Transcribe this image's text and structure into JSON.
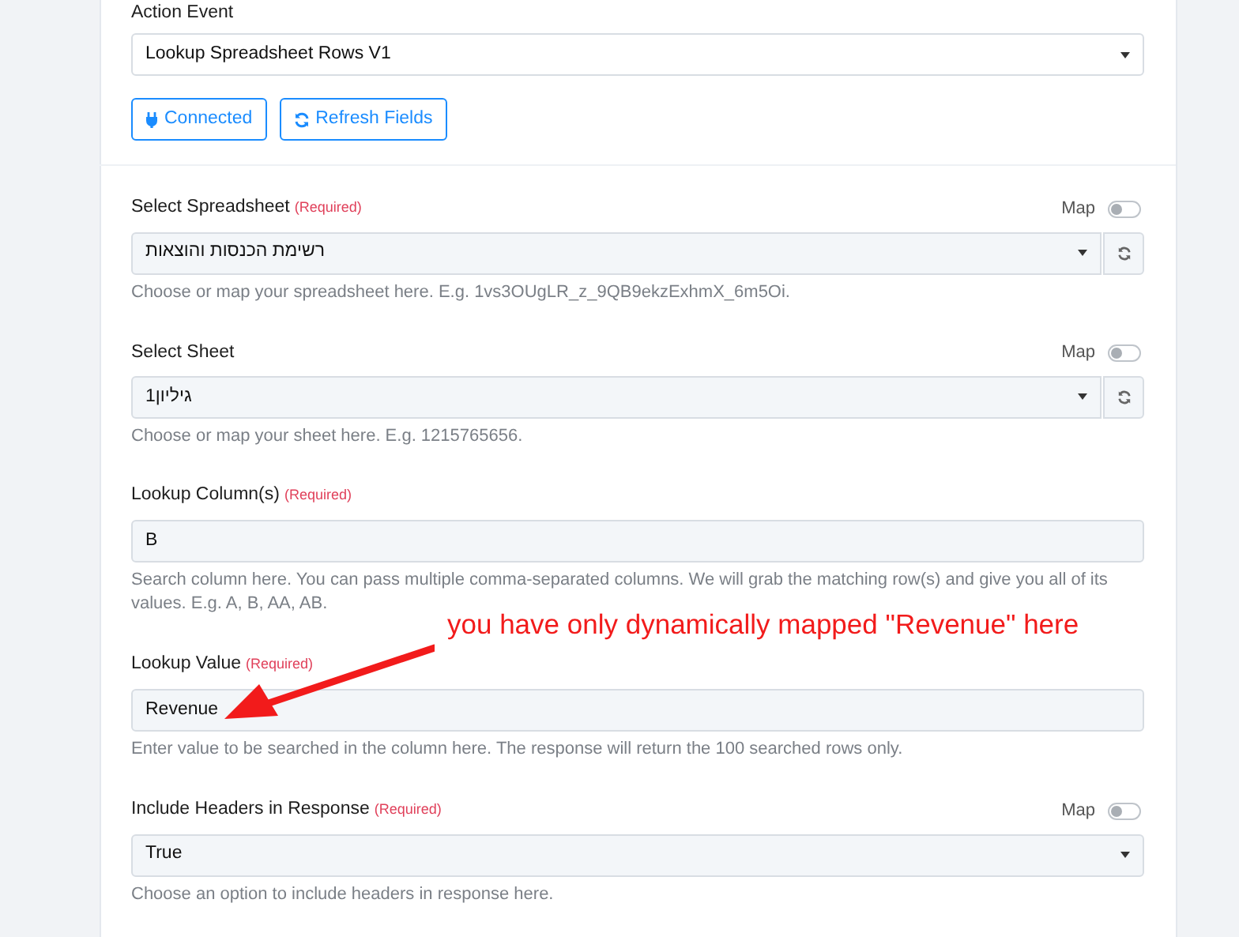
{
  "action_event": {
    "label": "Action Event",
    "value": "Lookup Spreadsheet Rows V1"
  },
  "buttons": [
    {
      "label": "Connected",
      "kind": "plug"
    },
    {
      "label": "Refresh Fields",
      "kind": "refresh"
    }
  ],
  "fields": [
    {
      "kind": "select",
      "label": "Select Spreadsheet",
      "required": "(Required)",
      "map": {
        "label": "Map",
        "on": false
      },
      "value": "רשימת הכנסות והוצאות",
      "refresh_button": true,
      "help": "Choose or map your spreadsheet here. E.g. 1vs3OUgLR_z_9QB9ekzExhmX_6m5Oi."
    },
    {
      "kind": "select",
      "label": "Select Sheet",
      "map": {
        "label": "Map",
        "on": false
      },
      "value": "גיליון1",
      "refresh_button": true,
      "help": "Choose or map your sheet here. E.g. 1215765656."
    },
    {
      "kind": "input",
      "label": "Lookup Column(s)",
      "required": "(Required)",
      "value": "B",
      "help": "Search column here. You can pass multiple comma-separated columns. We will grab the matching row(s) and give you all of its values. E.g. A, B, AA, AB."
    },
    {
      "kind": "input",
      "label": "Lookup Value",
      "required": "(Required)",
      "value": "Revenue",
      "help": "Enter value to be searched in the column here. The response will return the 100 searched rows only."
    },
    {
      "kind": "select",
      "label": "Include Headers in Response",
      "required": "(Required)",
      "map": {
        "label": "Map",
        "on": false
      },
      "value": "True",
      "refresh_button": false,
      "help": "Choose an option to include headers in response here."
    }
  ],
  "annotation": {
    "text": "you have only dynamically mapped \"Revenue\" here"
  }
}
